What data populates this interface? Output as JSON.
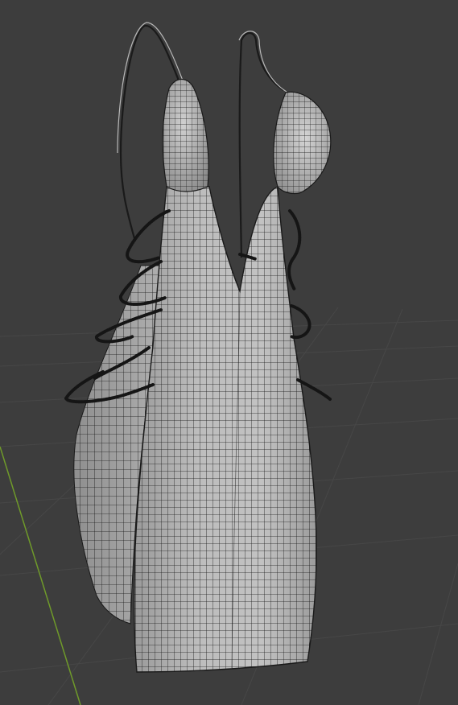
{
  "viewport": {
    "mode": "3d-viewport",
    "shading": "solid-wireframe",
    "background_color": "#3d3d3d",
    "grid_color": "#4a4a4a",
    "y_axis_color": "#6f9a2a",
    "mesh_fill_color": "#b4b4b4",
    "mesh_shade_color": "#8d8d8d",
    "wire_color": "#1a1a1a"
  },
  "object": {
    "type": "dress-mesh",
    "parts": [
      "front-panel",
      "back-panel",
      "left-strap",
      "right-strap",
      "left-cup",
      "right-cup",
      "left-lace-ties",
      "right-lace-ties"
    ]
  }
}
